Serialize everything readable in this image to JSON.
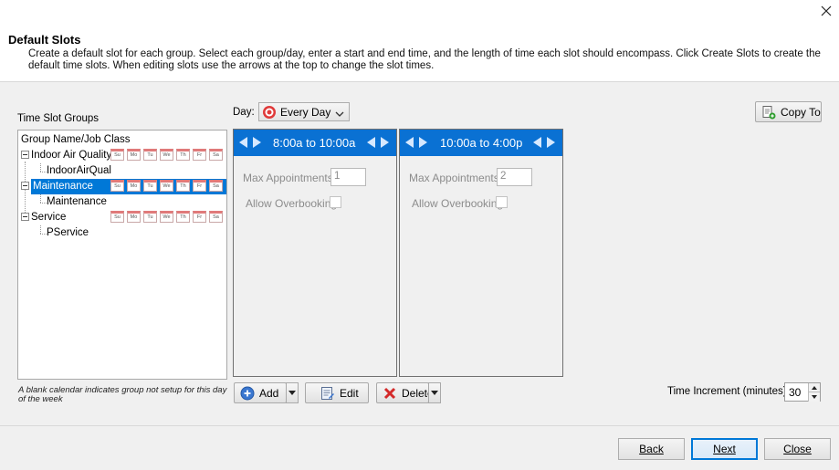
{
  "header": {
    "title": "Default Slots",
    "description": "Create a default slot for each group. Select each group/day, enter a start and end time, and the length of time each slot should encompass. Click Create Slots to create the default time slots. When editing slots use the arrows at the top to change the slot times."
  },
  "left": {
    "groups_label": "Time Slot Groups",
    "column_header": "Group Name/Job Class",
    "day_abbrevs": [
      "Su",
      "Mo",
      "Tu",
      "We",
      "Th",
      "Fr",
      "Sa"
    ],
    "tree": [
      {
        "label": "Indoor Air Quality",
        "child": "IndoorAirQual",
        "selected": false
      },
      {
        "label": "Maintenance",
        "child": "Maintenance",
        "selected": true
      },
      {
        "label": "Service",
        "child": "PService",
        "selected": false
      }
    ],
    "note": "A blank calendar indicates group not setup for this day of the week"
  },
  "day": {
    "label": "Day:",
    "value": "Every Day"
  },
  "copy_to": "Copy To",
  "slots": [
    {
      "time": "8:00a to 10:00a",
      "max_label": "Max Appointments",
      "max_value": "1",
      "overbook_label": "Allow Overbooking"
    },
    {
      "time": "10:00a to 4:00p",
      "max_label": "Max Appointments",
      "max_value": "2",
      "overbook_label": "Allow Overbooking"
    }
  ],
  "actions": {
    "add": "Add",
    "edit": "Edit",
    "delete": "Delete"
  },
  "increment": {
    "label": "Time Increment (minutes)",
    "value": "30"
  },
  "footer": {
    "back": "Back",
    "next": "Next",
    "close": "Close"
  },
  "colors": {
    "accent": "#0078d7",
    "slot_header": "#0a71d3"
  }
}
